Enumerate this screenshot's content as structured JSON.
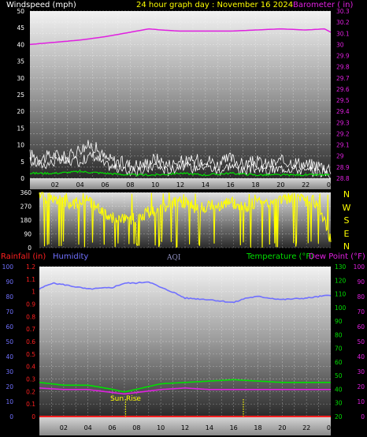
{
  "header": {
    "windspeed_label": "Windspeed (mph)",
    "title": "24 hour graph day : November 16 2024",
    "barometer_label": "Barometer ( in)"
  },
  "direction_letters": [
    "N",
    "W",
    "S",
    "E",
    "N"
  ],
  "legend": {
    "rainfall": "Rainfall (in)",
    "humidity": "Humidity",
    "aqi": "AQI",
    "temperature": "Temperature (°F)",
    "dewpoint": "Dew Point (°F)"
  },
  "annotation": {
    "sunrise": "Sun Rise"
  },
  "colors": {
    "windspeed_text": "#ffffff",
    "barometer": "#e020e0",
    "title": "#ffff00",
    "direction": "#ffff00",
    "rainfall": "#ff2020",
    "humidity": "#7070ff",
    "aqi": "#9090c0",
    "temperature": "#00e000",
    "dewpoint": "#e020e0",
    "wind_speed": "#ffffff",
    "wind_gust": "#ffffff",
    "wind_avg": "#00e000"
  },
  "chart_data": [
    {
      "type": "line",
      "title": "24 hour graph day : November 16 2024",
      "x": [
        "02",
        "04",
        "06",
        "08",
        "10",
        "12",
        "14",
        "16",
        "18",
        "20",
        "22",
        "00"
      ],
      "y_left": {
        "label": "Windspeed (mph)",
        "ticks": [
          0,
          5,
          10,
          15,
          20,
          25,
          30,
          35,
          40,
          45,
          50
        ],
        "ylim": [
          0,
          50
        ]
      },
      "y_right": {
        "label": "Barometer ( in)",
        "ticks": [
          "28.8",
          "28.9",
          "29",
          "29.1",
          "29.2",
          "29.3",
          "29.4",
          "29.5",
          "29.6",
          "29.7",
          "29.8",
          "29.9",
          "30",
          "30.1",
          "30.2",
          "30.3"
        ],
        "ylim": [
          28.8,
          30.3
        ]
      },
      "series": [
        {
          "name": "Barometer",
          "axis": "right",
          "x": [
            0,
            2,
            4,
            6,
            8,
            9.5,
            10.5,
            12,
            14,
            16,
            18,
            20,
            22,
            23.5,
            24
          ],
          "values": [
            30.0,
            30.02,
            30.04,
            30.07,
            30.11,
            30.14,
            30.13,
            30.12,
            30.12,
            30.12,
            30.13,
            30.14,
            30.13,
            30.14,
            30.11
          ]
        },
        {
          "name": "Wind Speed",
          "axis": "left",
          "x": [
            0,
            1,
            2,
            3,
            4,
            5,
            6,
            7,
            8,
            9,
            10,
            11,
            12,
            13,
            14,
            15,
            16,
            17,
            18,
            19,
            20,
            21,
            22,
            23,
            24
          ],
          "values": [
            5,
            4,
            5,
            5,
            5,
            7,
            4,
            3,
            2,
            2,
            4,
            2,
            4,
            3,
            4,
            2,
            4,
            2,
            3,
            2,
            3,
            3,
            2,
            2,
            1
          ]
        },
        {
          "name": "Wind Gust",
          "axis": "left",
          "x": [
            0,
            1,
            2,
            3,
            4,
            5,
            6,
            7,
            8,
            9,
            10,
            11,
            12,
            13,
            14,
            15,
            16,
            17,
            18,
            19,
            20,
            21,
            22,
            23,
            24
          ],
          "values": [
            7,
            6,
            7,
            6,
            9,
            10,
            6,
            5,
            4,
            4,
            6,
            4,
            5,
            5,
            6,
            4,
            6,
            4,
            5,
            4,
            5,
            5,
            4,
            4,
            3
          ]
        },
        {
          "name": "Wind Average",
          "axis": "left",
          "x": [
            0,
            2,
            4,
            6,
            8,
            10,
            12,
            14,
            16,
            18,
            20,
            22,
            24
          ],
          "values": [
            1.5,
            1.5,
            2,
            1.5,
            1,
            1,
            1.5,
            1,
            1.5,
            1,
            1,
            1,
            1
          ]
        }
      ],
      "grid": true
    },
    {
      "type": "line",
      "x": [
        "02",
        "04",
        "06",
        "08",
        "10",
        "12",
        "14",
        "16",
        "18",
        "20",
        "22",
        "00"
      ],
      "y_left": {
        "ticks": [
          0,
          90,
          180,
          270,
          360
        ],
        "ylim": [
          0,
          360
        ]
      },
      "y_right": {
        "ticks": [
          "N",
          "W",
          "S",
          "E",
          "N"
        ]
      },
      "series": [
        {
          "name": "Wind Direction",
          "x": [
            0,
            1,
            2,
            3,
            4,
            5,
            6,
            7,
            8,
            9,
            10,
            11,
            12,
            13,
            14,
            15,
            16,
            17,
            18,
            19,
            20,
            21,
            22,
            23,
            24
          ],
          "values": [
            340,
            320,
            300,
            290,
            310,
            250,
            200,
            180,
            200,
            230,
            240,
            300,
            300,
            250,
            270,
            280,
            290,
            270,
            300,
            300,
            310,
            320,
            300,
            280,
            40
          ]
        }
      ],
      "grid": true
    },
    {
      "type": "line",
      "x": [
        "02",
        "04",
        "06",
        "08",
        "10",
        "12",
        "14",
        "16",
        "18",
        "20",
        "22",
        "00"
      ],
      "axes": {
        "rainfall": {
          "label": "Rainfall (in)",
          "ticks": [
            "0",
            "0.1",
            "0.2",
            "0.3",
            "0.4",
            "0.5",
            "0.6",
            "0.7",
            "0.8",
            "0.9",
            "1",
            "1.1",
            "1.2"
          ],
          "ylim": [
            0,
            1.2
          ]
        },
        "humidity": {
          "label": "Humidity",
          "ticks": [
            0,
            10,
            20,
            30,
            40,
            50,
            60,
            70,
            80,
            90,
            100
          ],
          "ylim": [
            0,
            100
          ]
        },
        "temperature": {
          "label": "Temperature (°F)",
          "ticks": [
            20,
            30,
            40,
            50,
            60,
            70,
            80,
            90,
            100,
            110,
            120,
            130
          ],
          "ylim": [
            20,
            130
          ]
        },
        "dewpoint": {
          "label": "Dew Point (°F)",
          "ticks": [
            0,
            10,
            20,
            30,
            40,
            50,
            60,
            70,
            80,
            90,
            100
          ],
          "ylim": [
            0,
            100
          ]
        }
      },
      "series": [
        {
          "name": "Humidity",
          "axis": "humidity",
          "x": [
            0,
            1,
            2,
            4,
            6,
            7,
            8,
            9,
            10,
            11,
            12,
            14,
            16,
            17,
            18,
            20,
            22,
            24
          ],
          "values": [
            85,
            89,
            88,
            85,
            86,
            89,
            89,
            90,
            86,
            83,
            79,
            78,
            76,
            79,
            80,
            78,
            79,
            81
          ]
        },
        {
          "name": "Temperature",
          "axis": "temperature",
          "x": [
            0,
            2,
            4,
            6,
            7,
            8,
            10,
            12,
            14,
            16,
            18,
            20,
            22,
            24
          ],
          "values": [
            45,
            43,
            43,
            40,
            38,
            40,
            44,
            45,
            46,
            47,
            46,
            45,
            45,
            45
          ]
        },
        {
          "name": "Dew Point",
          "axis": "dewpoint",
          "x": [
            0,
            2,
            4,
            6,
            7,
            8,
            10,
            12,
            14,
            16,
            18,
            20,
            22,
            24
          ],
          "values": [
            19,
            18,
            18,
            16,
            15,
            16,
            18,
            19,
            18,
            18,
            18,
            18,
            18,
            18
          ]
        },
        {
          "name": "Rainfall",
          "axis": "rainfall",
          "x": [
            0,
            24
          ],
          "values": [
            0,
            0
          ]
        }
      ],
      "annotations": [
        {
          "text": "Sun Rise",
          "x": 7.1
        },
        {
          "text": "",
          "x": 16.8
        }
      ],
      "grid": true
    }
  ]
}
